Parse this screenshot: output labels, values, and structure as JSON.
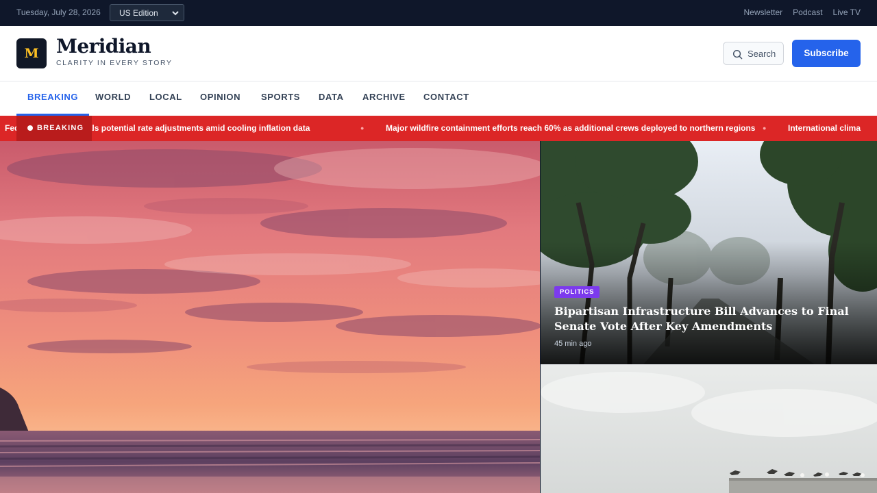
{
  "topbar": {
    "date": "Tuesday, July 28, 2026",
    "edition": "US Edition",
    "links": [
      "Newsletter",
      "Podcast",
      "Live TV"
    ]
  },
  "header": {
    "logo_letter": "M",
    "brand": "Meridian",
    "tagline": "CLARITY IN EVERY STORY",
    "search_label": "Search",
    "subscribe_label": "Subscribe"
  },
  "nav": {
    "items": [
      "BREAKING",
      "WORLD",
      "LOCAL",
      "OPINION",
      "SPORTS",
      "DATA",
      "ARCHIVE",
      "CONTACT"
    ],
    "active": "BREAKING"
  },
  "ticker": {
    "label": "BREAKING",
    "headlines": [
      "Federal Reserve signals potential rate adjustments amid cooling inflation data",
      "Major wildfire containment efforts reach 60% as additional crews deployed to northern regions",
      "International clima"
    ]
  },
  "hero": {
    "image": "sunset-over-ocean"
  },
  "cards": [
    {
      "tag": "POLITICS",
      "title": "Bipartisan Infrastructure Bill Advances to Final Senate Vote After Key Amendments",
      "time": "45 min ago",
      "image": "tree-lined-road-in-fog"
    },
    {
      "image": "seabirds-on-concrete-wall"
    }
  ],
  "colors": {
    "topbar_bg": "#0f172a",
    "accent": "#2563eb",
    "ticker_bg": "#dc2626",
    "politics_tag": "#7c3aed",
    "logo_letter": "#fbbf24"
  }
}
